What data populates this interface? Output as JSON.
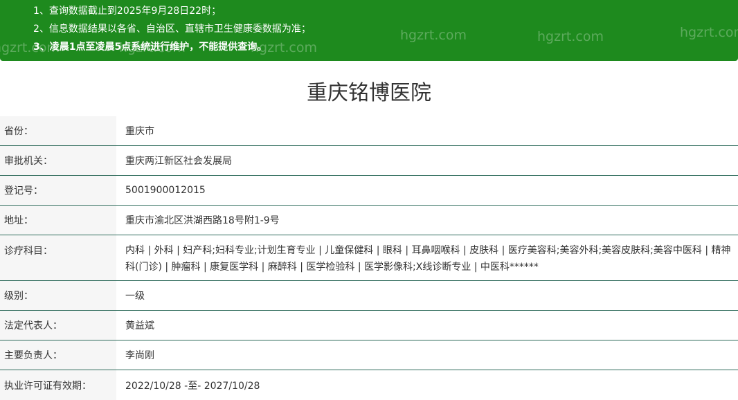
{
  "notice": {
    "lines": [
      "1、查询数据截止到2025年9月28日22时；",
      "2、信息数据结果以各省、自治区、直辖市卫生健康委数据为准；",
      "3、凌晨1点至凌晨5点系统进行维护，不能提供查询。"
    ],
    "watermark": "hgzrt.com"
  },
  "hospital": {
    "name": "重庆铭博医院"
  },
  "fields": [
    {
      "label": "省份：",
      "value": "重庆市"
    },
    {
      "label": "审批机关：",
      "value": "重庆两江新区社会发展局"
    },
    {
      "label": "登记号：",
      "value": "5001900012015"
    },
    {
      "label": "地址：",
      "value": "重庆市渝北区洪湖西路18号附1-9号"
    },
    {
      "label": "诊疗科目：",
      "value": "内科 | 外科 | 妇产科;妇科专业;计划生育专业 | 儿童保健科 | 眼科 | 耳鼻咽喉科 | 皮肤科 | 医疗美容科;美容外科;美容皮肤科;美容中医科 | 精神科(门诊) | 肿瘤科 | 康复医学科 | 麻醉科 | 医学检验科 | 医学影像科;X线诊断专业 | 中医科******"
    },
    {
      "label": "级别：",
      "value": "一级"
    },
    {
      "label": "法定代表人：",
      "value": "黄益斌"
    },
    {
      "label": "主要负责人：",
      "value": "李尚刚"
    },
    {
      "label": "执业许可证有效期：",
      "value": "2022/10/28 -至- 2027/10/28"
    }
  ]
}
